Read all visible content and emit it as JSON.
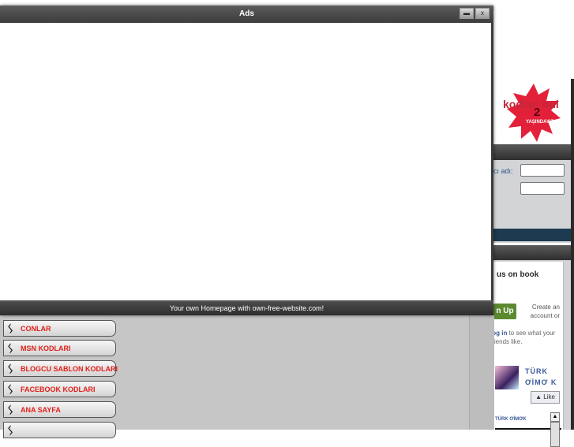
{
  "popup": {
    "title": "Ads",
    "minimize_icon": "minimize-icon",
    "close_icon": "close-icon",
    "close_symbol": "x",
    "footer_text": "Your own Homepage with own-free-website.com!"
  },
  "logo": {
    "text": "kodları bul",
    "number": "2",
    "subtitle": "YAŞINDAYIZ"
  },
  "login": {
    "username_label": "cı adı:"
  },
  "facebook": {
    "title": "us on book",
    "signup_label": "n Up",
    "create_text": "Create an account or",
    "login_link": "log in",
    "login_suffix": "to see what your friends like.",
    "page_name": "TÜRK ƠİMƠ K",
    "like_label": "Like",
    "feed_name": "TÜRK ƠİMƠK"
  },
  "menu": {
    "icon": "running-figure-icon",
    "items": [
      {
        "label": "CONLAR"
      },
      {
        "label": "MSN KODLARI"
      },
      {
        "label": "BLOGCU SABLON KODLARI"
      },
      {
        "label": "FACEBOOK KODLARI"
      },
      {
        "label": "ANA SAYFA"
      },
      {
        "label": ""
      }
    ]
  }
}
